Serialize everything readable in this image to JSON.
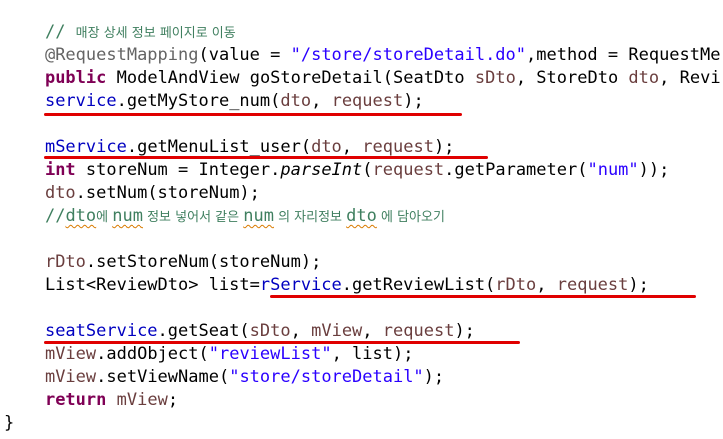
{
  "code": {
    "comment_header": "매장 상세 정보 페이지로 이동",
    "annotation": "@RequestMapping(value = \"/store/storeDetail.do\",method = RequestMe",
    "signature": "goStoreDetail(SeatDto sDto, StoreDto dto, Revi",
    "modifiers": "public",
    "return_type": "ModelAndView",
    "stmt_mystore": "service.getMyStore_num(dto, request);",
    "stmt_menulist": "mService.getMenuList_user(dto, request);",
    "stmt_storenum_kw": "int",
    "stmt_storenum": "storeNum = Integer.parseInt(request.getParameter(\"num\"));",
    "stmt_setnum": "dto.setNum(storeNum);",
    "comment_inline": "//dto에 num 정보 넣어서 같은 num 의 자리정보 dto 에 담아오기",
    "stmt_setstorenum": "rDto.setStoreNum(storeNum);",
    "stmt_reviewlist": "List<ReviewDto> list=rService.getReviewList(rDto, request);",
    "stmt_getseat": "seatService.getSeat(sDto, mView, request);",
    "stmt_addobject": "mView.addObject(\"reviewList\", list);",
    "stmt_setviewname": "mView.setViewName(\"store/storeDetail\");",
    "stmt_return_kw": "return",
    "stmt_return": "mView;",
    "closing_brace": "}"
  },
  "colors": {
    "keyword": "#7f0055",
    "field": "#0000c0",
    "string": "#2a00ff",
    "comment": "#3f7f5f",
    "annotation": "#646464",
    "local": "#6a3e3e",
    "marker": "#e00000"
  }
}
